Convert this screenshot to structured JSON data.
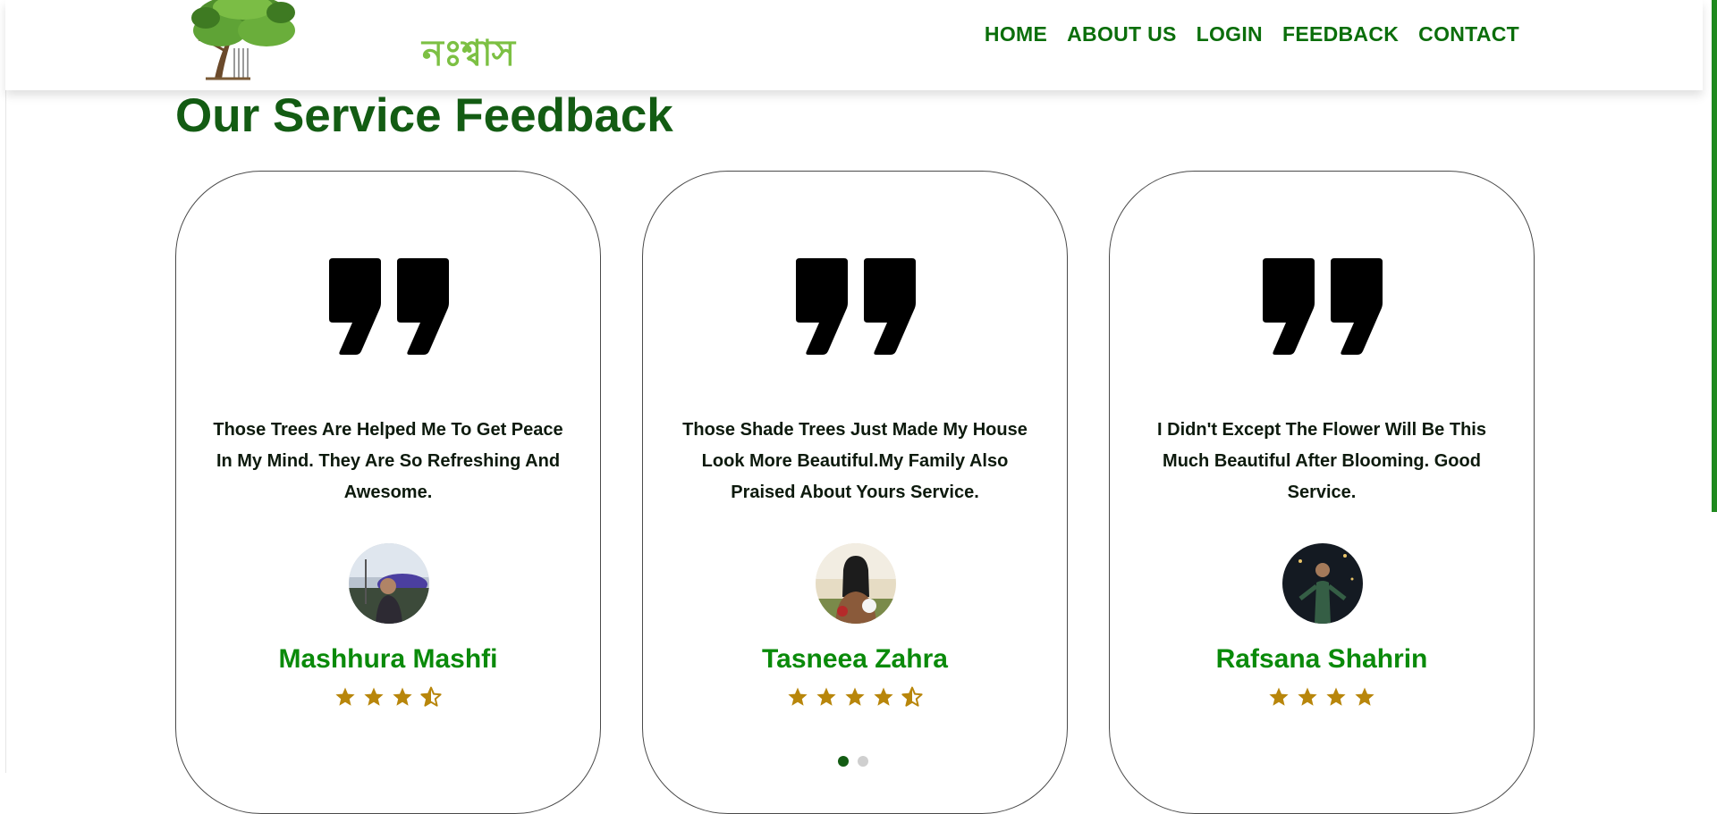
{
  "brand": {
    "logo_text": "নঃশ্বাস"
  },
  "nav": {
    "items": [
      {
        "label": "HOME"
      },
      {
        "label": "ABOUT US"
      },
      {
        "label": "LOGIN"
      },
      {
        "label": "FEEDBACK"
      },
      {
        "label": "CONTACT"
      }
    ]
  },
  "feedback": {
    "title": "Our Service Feedback",
    "cards": [
      {
        "text": "Those Trees Are Helped Me To Get Peace In My Mind. They Are So Refreshing And Awesome.",
        "name": "Mashhura Mashfi",
        "rating": 3.5
      },
      {
        "text": "Those Shade Trees Just Made My House Look More Beautiful.My Family Also Praised About Yours Service.",
        "name": "Tasneea Zahra",
        "rating": 4.5
      },
      {
        "text": "I Didn't Except The Flower Will Be This Much Beautiful After Blooming. Good Service.",
        "name": "Rafsana Shahrin",
        "rating": 4
      }
    ],
    "pagination": {
      "pages": 2,
      "active": 1
    }
  },
  "colors": {
    "nav_text": "#0b6e0b",
    "title": "#135c13",
    "name": "#0a8a0a",
    "star": "#b8860b",
    "scrollbar": "#1f8a1f"
  }
}
